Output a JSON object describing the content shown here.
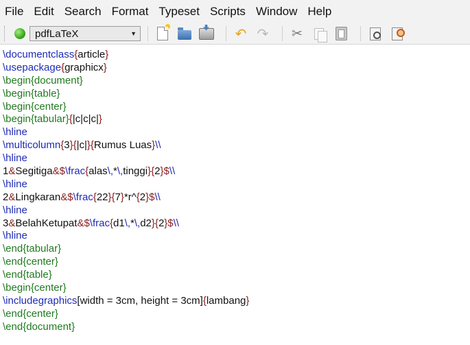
{
  "menu": [
    "File",
    "Edit",
    "Search",
    "Format",
    "Typeset",
    "Scripts",
    "Window",
    "Help"
  ],
  "toolbar": {
    "typeset_engine": "pdfLaTeX",
    "buttons": [
      "new-document",
      "open",
      "save",
      "undo",
      "redo",
      "cut",
      "copy",
      "paste",
      "find",
      "replace"
    ]
  },
  "colors": {
    "command": "#1e2bb7",
    "environment": "#1f7a1f",
    "brace": "#8b1d1d",
    "text": "#111111"
  },
  "editor": {
    "lines": [
      [
        [
          "cmd",
          "\\documentclass"
        ],
        [
          "brace",
          "{"
        ],
        [
          "txt",
          "article"
        ],
        [
          "brace",
          "}"
        ]
      ],
      [
        [
          "cmd",
          "\\usepackage"
        ],
        [
          "brace",
          "{"
        ],
        [
          "txt",
          "graphicx"
        ],
        [
          "brace",
          "}"
        ]
      ],
      [
        [
          "env",
          "\\begin{document}"
        ]
      ],
      [
        [
          "env",
          "\\begin{table}"
        ]
      ],
      [
        [
          "env",
          "\\begin{center}"
        ]
      ],
      [
        [
          "env",
          "\\begin{tabular}"
        ],
        [
          "brace",
          "{"
        ],
        [
          "txt",
          "|c|c|c|"
        ],
        [
          "brace",
          "}"
        ]
      ],
      [
        [
          "cmd",
          "\\hline"
        ]
      ],
      [
        [
          "cmd",
          "\\multicolumn"
        ],
        [
          "brace",
          "{"
        ],
        [
          "txt",
          "3"
        ],
        [
          "brace",
          "}{"
        ],
        [
          "txt",
          "|c|"
        ],
        [
          "brace",
          "}{"
        ],
        [
          "txt",
          "Rumus Luas"
        ],
        [
          "brace",
          "}"
        ],
        [
          "cmd",
          "\\\\"
        ]
      ],
      [
        [
          "cmd",
          "\\hline"
        ]
      ],
      [
        [
          "txt",
          "1"
        ],
        [
          "brace",
          "&"
        ],
        [
          "txt",
          "Segitiga"
        ],
        [
          "brace",
          "&$"
        ],
        [
          "cmd",
          "\\frac"
        ],
        [
          "brace",
          "{"
        ],
        [
          "txt",
          "alas"
        ],
        [
          "cmd",
          "\\,"
        ],
        [
          "txt",
          "*"
        ],
        [
          "cmd",
          "\\,"
        ],
        [
          "txt",
          "tinggi"
        ],
        [
          "brace",
          "}{"
        ],
        [
          "txt",
          "2"
        ],
        [
          "brace",
          "}$"
        ],
        [
          "cmd",
          "\\\\"
        ]
      ],
      [
        [
          "cmd",
          "\\hline"
        ]
      ],
      [
        [
          "txt",
          "2"
        ],
        [
          "brace",
          "&"
        ],
        [
          "txt",
          "Lingkaran"
        ],
        [
          "brace",
          "&$"
        ],
        [
          "cmd",
          "\\frac"
        ],
        [
          "brace",
          "{"
        ],
        [
          "txt",
          "22"
        ],
        [
          "brace",
          "}{"
        ],
        [
          "txt",
          "7"
        ],
        [
          "brace",
          "}"
        ],
        [
          "txt",
          "*r^"
        ],
        [
          "brace",
          "{"
        ],
        [
          "txt",
          "2"
        ],
        [
          "brace",
          "}$"
        ],
        [
          "cmd",
          "\\\\"
        ]
      ],
      [
        [
          "cmd",
          "\\hline"
        ]
      ],
      [
        [
          "txt",
          "3"
        ],
        [
          "brace",
          "&"
        ],
        [
          "txt",
          "BelahKetupat"
        ],
        [
          "brace",
          "&$"
        ],
        [
          "cmd",
          "\\frac"
        ],
        [
          "brace",
          "{"
        ],
        [
          "txt",
          "d1"
        ],
        [
          "cmd",
          "\\,"
        ],
        [
          "txt",
          "*"
        ],
        [
          "cmd",
          "\\,"
        ],
        [
          "txt",
          "d2"
        ],
        [
          "brace",
          "}{"
        ],
        [
          "txt",
          "2"
        ],
        [
          "brace",
          "}$"
        ],
        [
          "cmd",
          "\\\\"
        ]
      ],
      [
        [
          "cmd",
          "\\hline"
        ]
      ],
      [
        [
          "env",
          "\\end{tabular}"
        ]
      ],
      [
        [
          "env",
          "\\end{center}"
        ]
      ],
      [
        [
          "env",
          "\\end{table}"
        ]
      ],
      [
        [
          "env",
          "\\begin{center}"
        ]
      ],
      [
        [
          "cmd",
          "\\includegraphics"
        ],
        [
          "txt",
          "[width = 3cm, height = 3cm]"
        ],
        [
          "brace",
          "{"
        ],
        [
          "txt",
          "lambang"
        ],
        [
          "brace",
          "}"
        ]
      ],
      [
        [
          "env",
          "\\end{center}"
        ]
      ],
      [
        [
          "env",
          "\\end{document}"
        ]
      ]
    ]
  }
}
